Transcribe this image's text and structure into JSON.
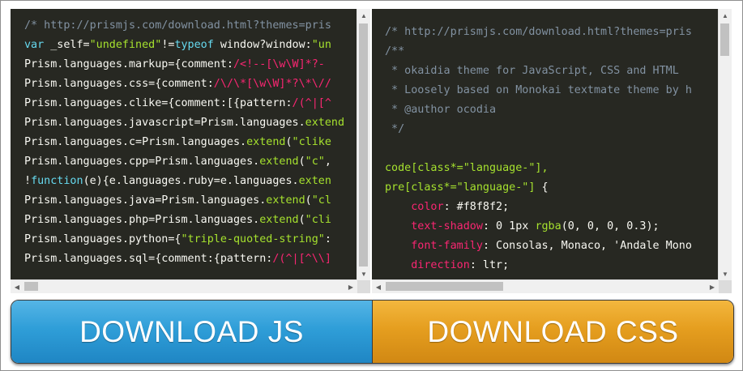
{
  "js_pane": {
    "lines": [
      [
        {
          "t": "/* http://prismjs.com/download.html?themes=pris",
          "c": "c-comment"
        }
      ],
      [
        {
          "t": "var",
          "c": "c-kw"
        },
        {
          "t": " _self=",
          "c": "c-plain"
        },
        {
          "t": "\"undefined\"",
          "c": "c-str"
        },
        {
          "t": "!=",
          "c": "c-plain"
        },
        {
          "t": "typeof",
          "c": "c-kw"
        },
        {
          "t": " window?window:",
          "c": "c-plain"
        },
        {
          "t": "\"un",
          "c": "c-str"
        }
      ],
      [
        {
          "t": "Prism.languages.markup={comment:",
          "c": "c-plain"
        },
        {
          "t": "/<!--[\\w\\W]*?-",
          "c": "c-red"
        }
      ],
      [
        {
          "t": "Prism.languages.css={comment:",
          "c": "c-plain"
        },
        {
          "t": "/\\/\\*[\\w\\W]*?\\*\\//",
          "c": "c-red"
        }
      ],
      [
        {
          "t": "Prism.languages.clike={comment:[{pattern:",
          "c": "c-plain"
        },
        {
          "t": "/(^|[^",
          "c": "c-red"
        }
      ],
      [
        {
          "t": "Prism.languages.javascript=Prism.languages.",
          "c": "c-plain"
        },
        {
          "t": "extend",
          "c": "c-str"
        }
      ],
      [
        {
          "t": "Prism.languages.c=Prism.languages.",
          "c": "c-plain"
        },
        {
          "t": "extend",
          "c": "c-str"
        },
        {
          "t": "(",
          "c": "c-plain"
        },
        {
          "t": "\"clike",
          "c": "c-str"
        }
      ],
      [
        {
          "t": "Prism.languages.cpp=Prism.languages.",
          "c": "c-plain"
        },
        {
          "t": "extend",
          "c": "c-str"
        },
        {
          "t": "(",
          "c": "c-plain"
        },
        {
          "t": "\"c\"",
          "c": "c-str"
        },
        {
          "t": ",",
          "c": "c-plain"
        }
      ],
      [
        {
          "t": "!",
          "c": "c-plain"
        },
        {
          "t": "function",
          "c": "c-kw"
        },
        {
          "t": "(e){e.languages.ruby=e.languages.",
          "c": "c-plain"
        },
        {
          "t": "exten",
          "c": "c-str"
        }
      ],
      [
        {
          "t": "Prism.languages.java=Prism.languages.",
          "c": "c-plain"
        },
        {
          "t": "extend",
          "c": "c-str"
        },
        {
          "t": "(",
          "c": "c-plain"
        },
        {
          "t": "\"cl",
          "c": "c-str"
        }
      ],
      [
        {
          "t": "Prism.languages.php=Prism.languages.",
          "c": "c-plain"
        },
        {
          "t": "extend",
          "c": "c-str"
        },
        {
          "t": "(",
          "c": "c-plain"
        },
        {
          "t": "\"cli",
          "c": "c-str"
        }
      ],
      [
        {
          "t": "Prism.languages.python={",
          "c": "c-plain"
        },
        {
          "t": "\"triple-quoted-string\"",
          "c": "c-str"
        },
        {
          "t": ":",
          "c": "c-plain"
        }
      ],
      [
        {
          "t": "Prism.languages.sql={comment:{pattern:",
          "c": "c-plain"
        },
        {
          "t": "/(^|[^\\\\]",
          "c": "c-red"
        }
      ]
    ]
  },
  "css_pane": {
    "lines": [
      [
        {
          "t": "/* http://prismjs.com/download.html?themes=pris",
          "c": "c-comment"
        }
      ],
      [
        {
          "t": "/**",
          "c": "c-comment"
        }
      ],
      [
        {
          "t": " * okaidia theme for JavaScript, CSS and HTML",
          "c": "c-comment"
        }
      ],
      [
        {
          "t": " * Loosely based on Monokai textmate theme by h",
          "c": "c-comment"
        }
      ],
      [
        {
          "t": " * @author ocodia",
          "c": "c-comment"
        }
      ],
      [
        {
          "t": " */",
          "c": "c-comment"
        }
      ],
      [
        {
          "t": "",
          "c": "c-plain"
        }
      ],
      [
        {
          "t": "code[class*=\"language-\"],",
          "c": "c-str"
        }
      ],
      [
        {
          "t": "pre[class*=\"language-\"]",
          "c": "c-str"
        },
        {
          "t": " {",
          "c": "c-plain"
        }
      ],
      [
        {
          "t": "    ",
          "c": "c-plain"
        },
        {
          "t": "color",
          "c": "c-red"
        },
        {
          "t": ": #f8f8f2;",
          "c": "c-plain"
        }
      ],
      [
        {
          "t": "    ",
          "c": "c-plain"
        },
        {
          "t": "text-shadow",
          "c": "c-red"
        },
        {
          "t": ": 0 1px ",
          "c": "c-plain"
        },
        {
          "t": "rgba",
          "c": "c-str"
        },
        {
          "t": "(0, 0, 0, 0.3);",
          "c": "c-plain"
        }
      ],
      [
        {
          "t": "    ",
          "c": "c-plain"
        },
        {
          "t": "font-family",
          "c": "c-red"
        },
        {
          "t": ": Consolas, Monaco, 'Andale Mono",
          "c": "c-plain"
        }
      ],
      [
        {
          "t": "    ",
          "c": "c-plain"
        },
        {
          "t": "direction",
          "c": "c-red"
        },
        {
          "t": ": ltr;",
          "c": "c-plain"
        }
      ]
    ]
  },
  "buttons": {
    "download_js": "DOWNLOAD JS",
    "download_css": "DOWNLOAD CSS"
  },
  "colors": {
    "code_bg": "#272822",
    "js_button": "#2f9ed8",
    "css_button": "#e59e1f"
  },
  "icons": {
    "scroll_up": "triangle-up-icon",
    "scroll_down": "triangle-down-icon",
    "scroll_left": "triangle-left-icon",
    "scroll_right": "triangle-right-icon"
  }
}
